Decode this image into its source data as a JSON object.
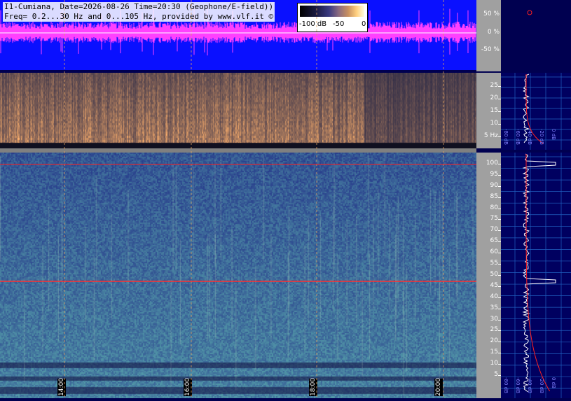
{
  "header": {
    "line1": "I1-Cumiana, Date=2026-08-26 Time=20:30 (Geophone/E-field))",
    "line2": "Freq= 0.2...30 Hz and 0...105 Hz, provided by www.vlf.it ©"
  },
  "scale": {
    "min_label": "-100 dB",
    "mid_label": "-50",
    "max_label": "0"
  },
  "wave_axis": [
    "50 %",
    "0 %",
    "-50 %"
  ],
  "spec1_axis": [
    "25",
    "20",
    "15",
    "10",
    "5 Hz"
  ],
  "spec2_axis": [
    "100",
    "95",
    "90",
    "85",
    "80",
    "75",
    "70",
    "65",
    "60",
    "55",
    "50",
    "45",
    "40",
    "35",
    "30",
    "25",
    "20",
    "15",
    "10",
    "5"
  ],
  "times": [
    "14:00",
    "16:00",
    "18:00",
    "20:00"
  ],
  "profile_labels": [
    "-100 dB",
    "-80 dB",
    "-60 dB",
    "-40 dB",
    "-20 dB",
    "0 dB"
  ],
  "colors": {
    "wave_bg": "#0a10ff",
    "wave_trace": "#ff40ff",
    "marker": "#ff2020",
    "panel_bg": "#000050"
  }
}
